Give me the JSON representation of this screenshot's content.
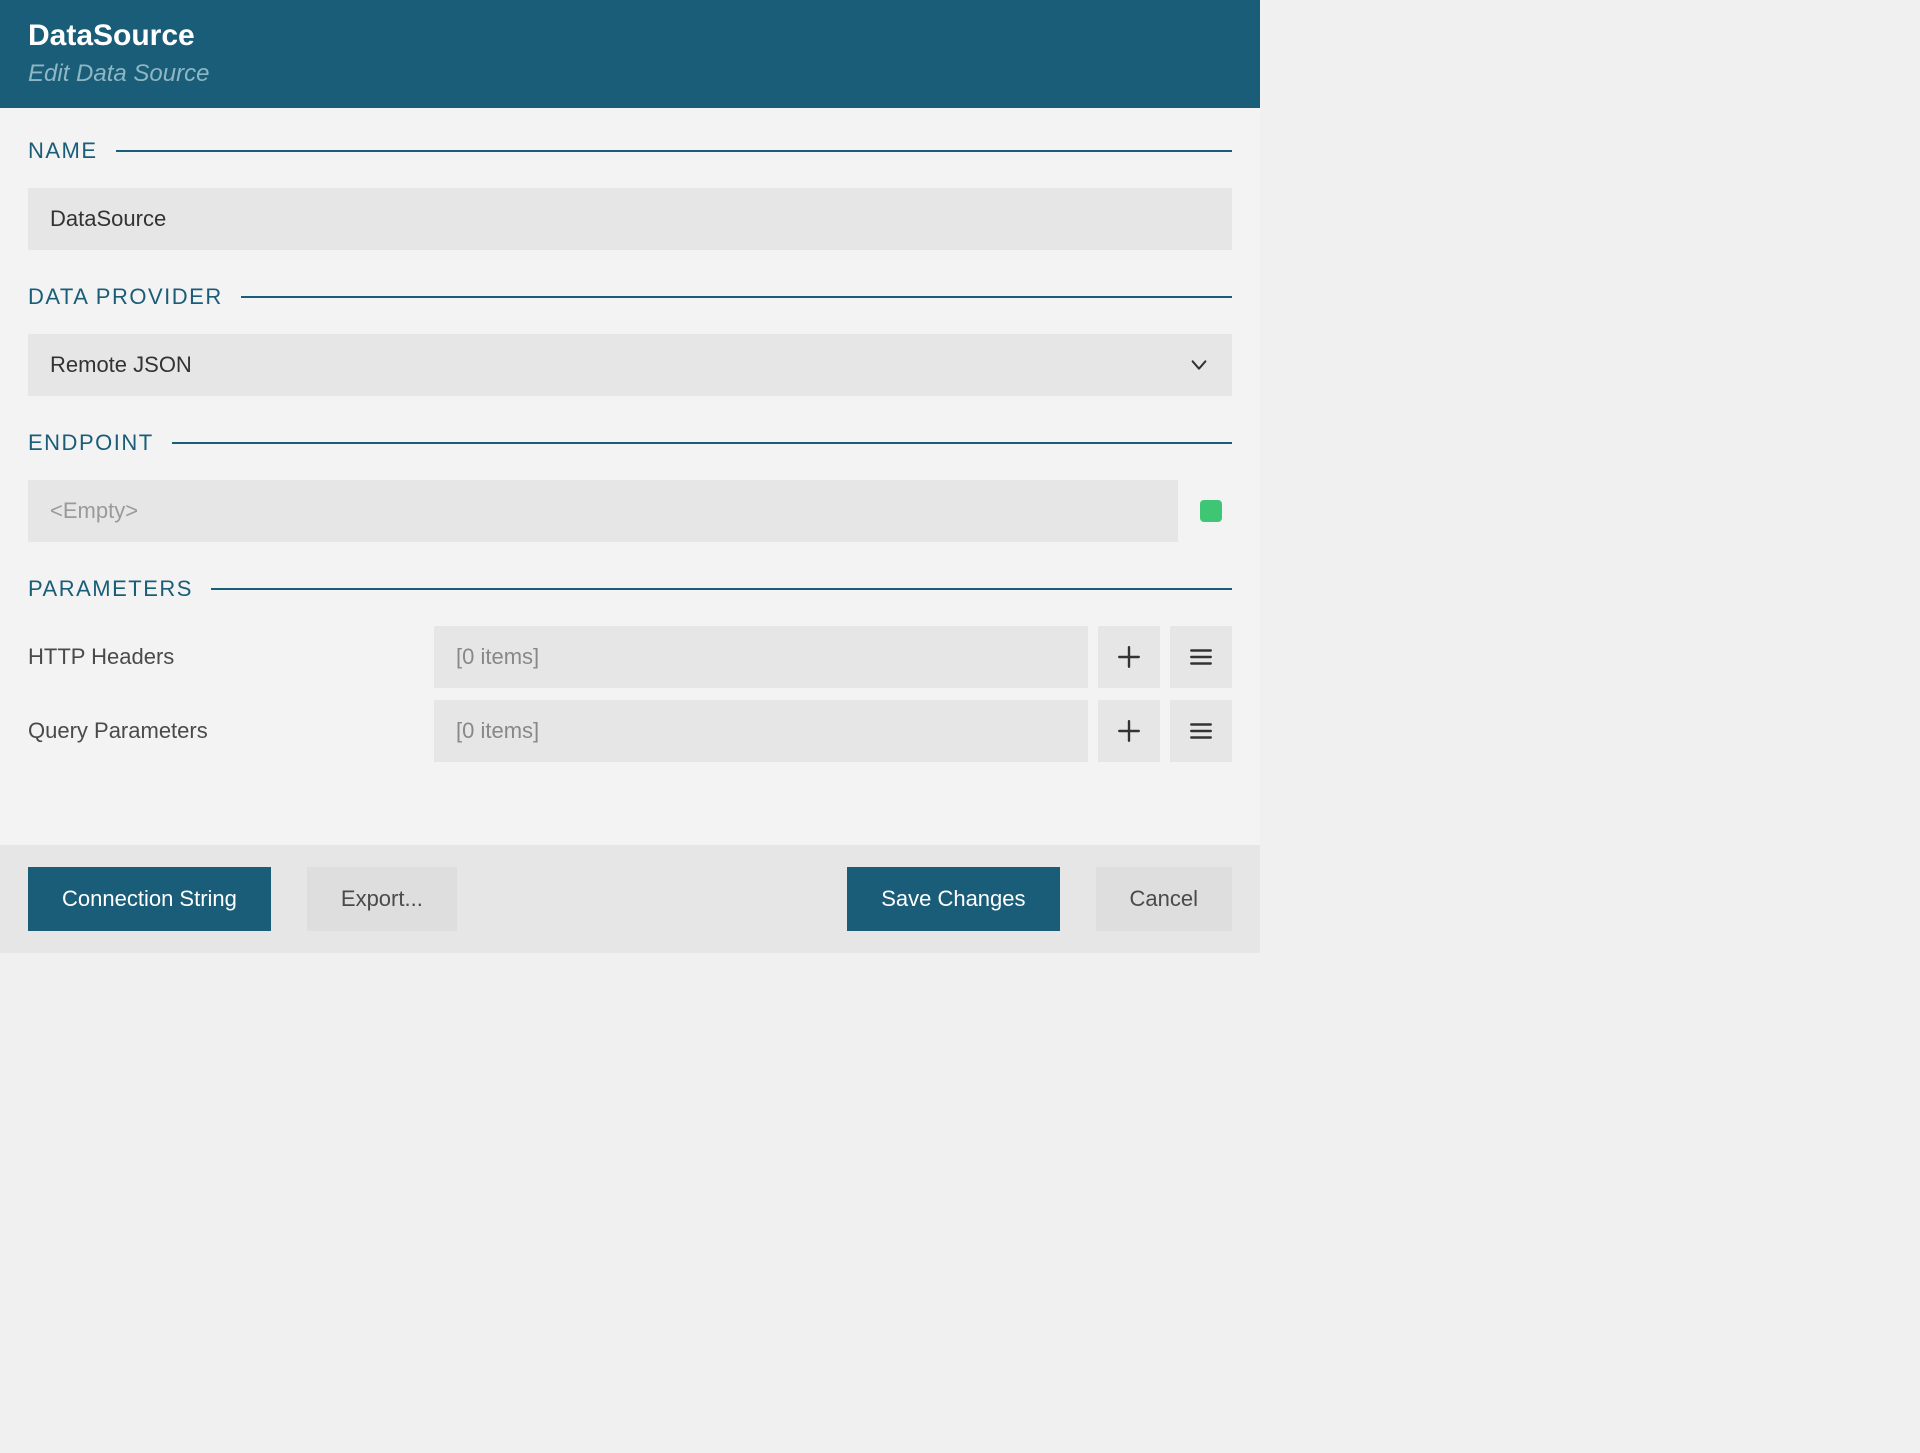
{
  "header": {
    "title": "DataSource",
    "subtitle": "Edit Data Source"
  },
  "sections": {
    "name": {
      "label": "NAME",
      "value": "DataSource"
    },
    "data_provider": {
      "label": "DATA PROVIDER",
      "selected": "Remote JSON"
    },
    "endpoint": {
      "label": "ENDPOINT",
      "value": "",
      "placeholder": "<Empty>",
      "status_color": "#3fc675"
    },
    "parameters": {
      "label": "PARAMETERS",
      "rows": {
        "http_headers": {
          "label": "HTTP Headers",
          "summary": "[0 items]"
        },
        "query_parameters": {
          "label": "Query Parameters",
          "summary": "[0 items]"
        }
      }
    }
  },
  "footer": {
    "connection_string": "Connection String",
    "export": "Export...",
    "save": "Save Changes",
    "cancel": "Cancel"
  }
}
